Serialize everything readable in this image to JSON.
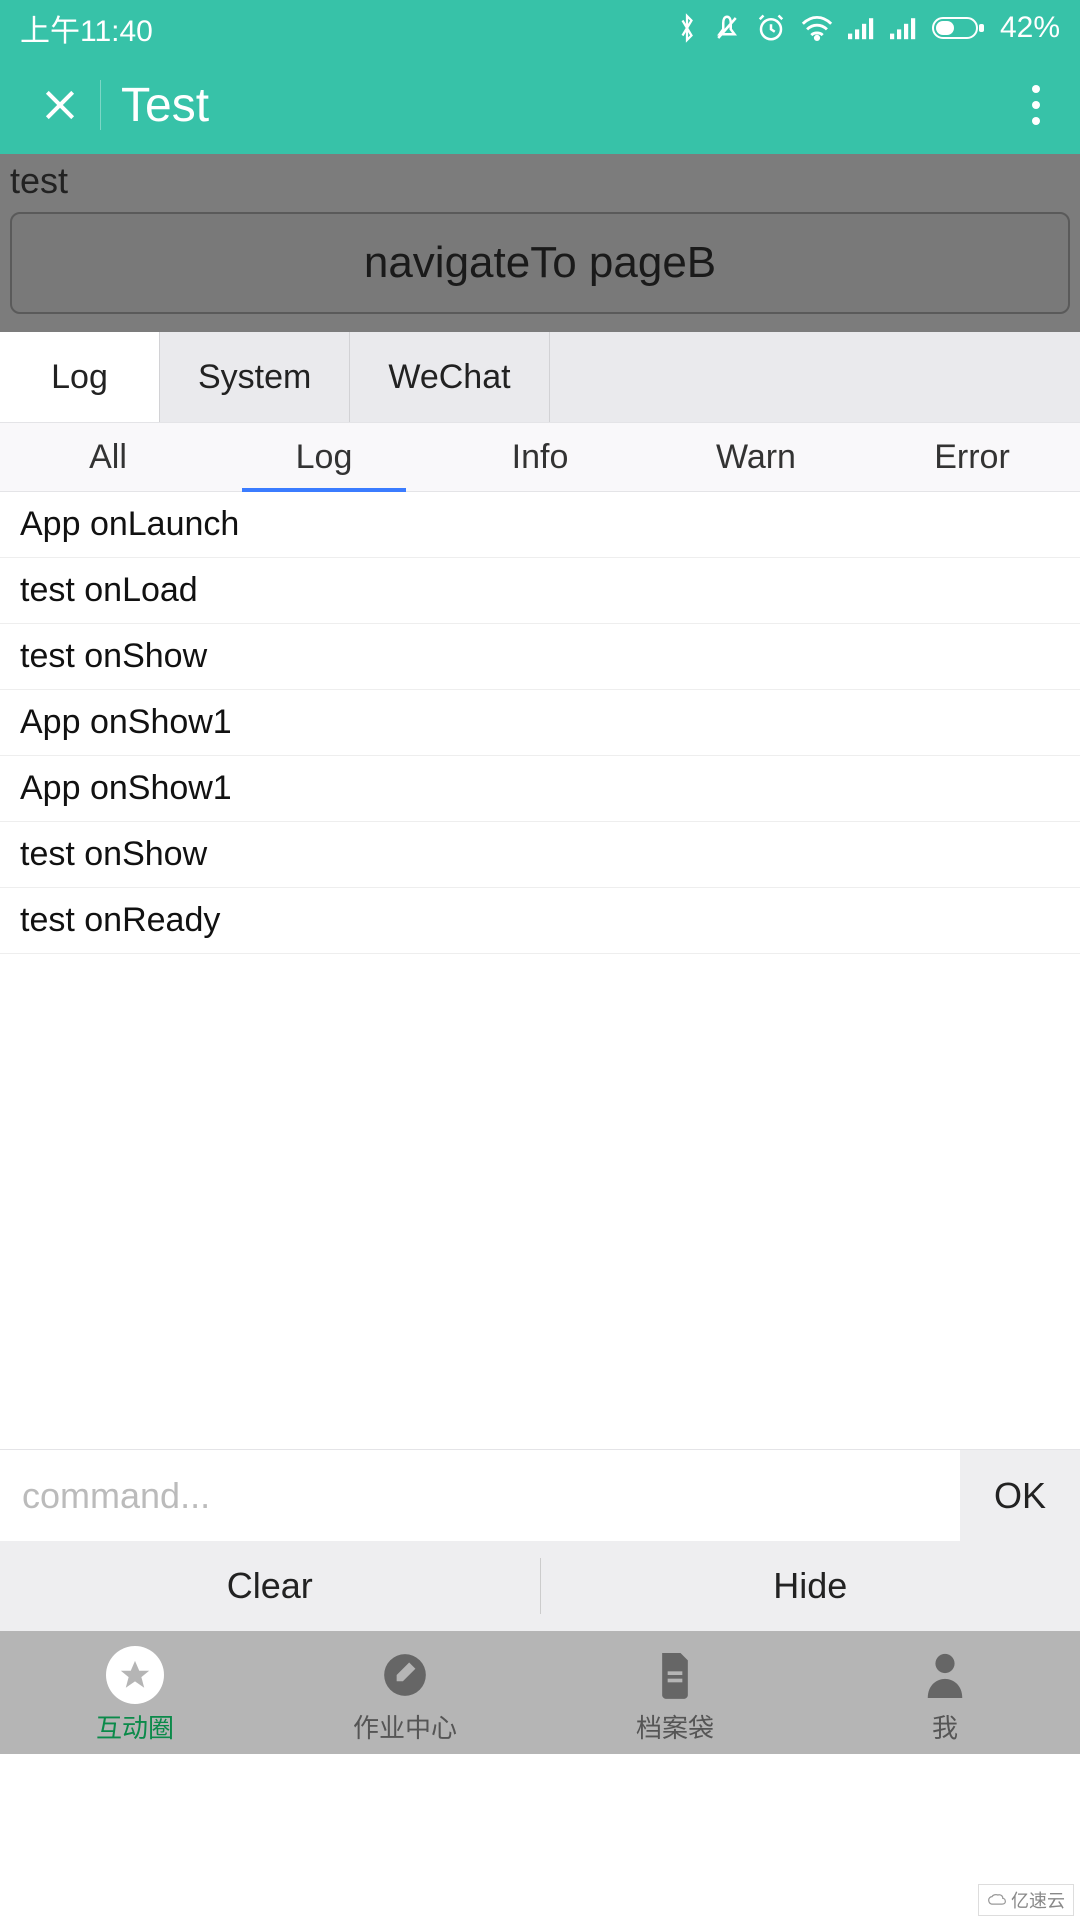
{
  "status_bar": {
    "time": "上午11:40",
    "battery": "42%"
  },
  "header": {
    "title": "Test"
  },
  "page": {
    "label": "test",
    "nav_button": "navigateTo pageB"
  },
  "console_tabs": [
    "Log",
    "System",
    "WeChat"
  ],
  "console_active_index": 0,
  "filter_tabs": [
    "All",
    "Log",
    "Info",
    "Warn",
    "Error"
  ],
  "filter_active_index": 1,
  "logs": [
    "App onLaunch",
    "test onLoad",
    "test onShow",
    "App onShow1",
    "App onShow1",
    "test onShow",
    "test onReady"
  ],
  "command": {
    "placeholder": "command...",
    "ok": "OK"
  },
  "actions": {
    "clear": "Clear",
    "hide": "Hide"
  },
  "bottom_nav": [
    {
      "label": "互动圈",
      "active": true
    },
    {
      "label": "作业中心",
      "active": false
    },
    {
      "label": "档案袋",
      "active": false
    },
    {
      "label": "我",
      "active": false
    }
  ],
  "watermark": "亿速云"
}
